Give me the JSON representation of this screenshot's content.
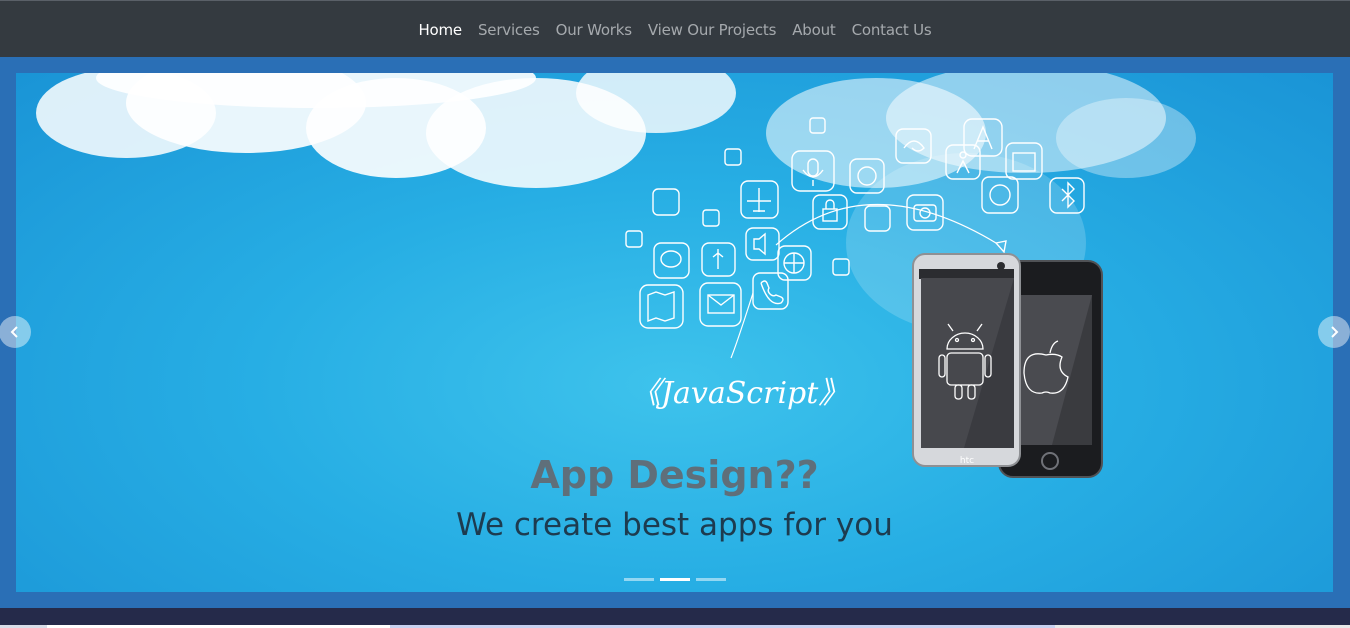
{
  "nav": {
    "items": [
      {
        "label": "Home",
        "active": true
      },
      {
        "label": "Services",
        "active": false
      },
      {
        "label": "Our Works",
        "active": false
      },
      {
        "label": "View Our Projects",
        "active": false
      },
      {
        "label": "About",
        "active": false
      },
      {
        "label": "Contact Us",
        "active": false
      }
    ]
  },
  "carousel": {
    "slide": {
      "title": "App Design??",
      "subtitle": "We create best apps for you",
      "image_text": "《JavaScript》",
      "phone_brand": "htc"
    },
    "indicator_count": 3,
    "active_indicator": 1,
    "prev_icon": "chevron-left-icon",
    "next_icon": "chevron-right-icon"
  },
  "colors": {
    "navbar": "#343a40",
    "sky": "#27aee4",
    "frame": "#2a6fb6",
    "title": "#5f6f7a",
    "subtitle": "#1d3b4f"
  }
}
